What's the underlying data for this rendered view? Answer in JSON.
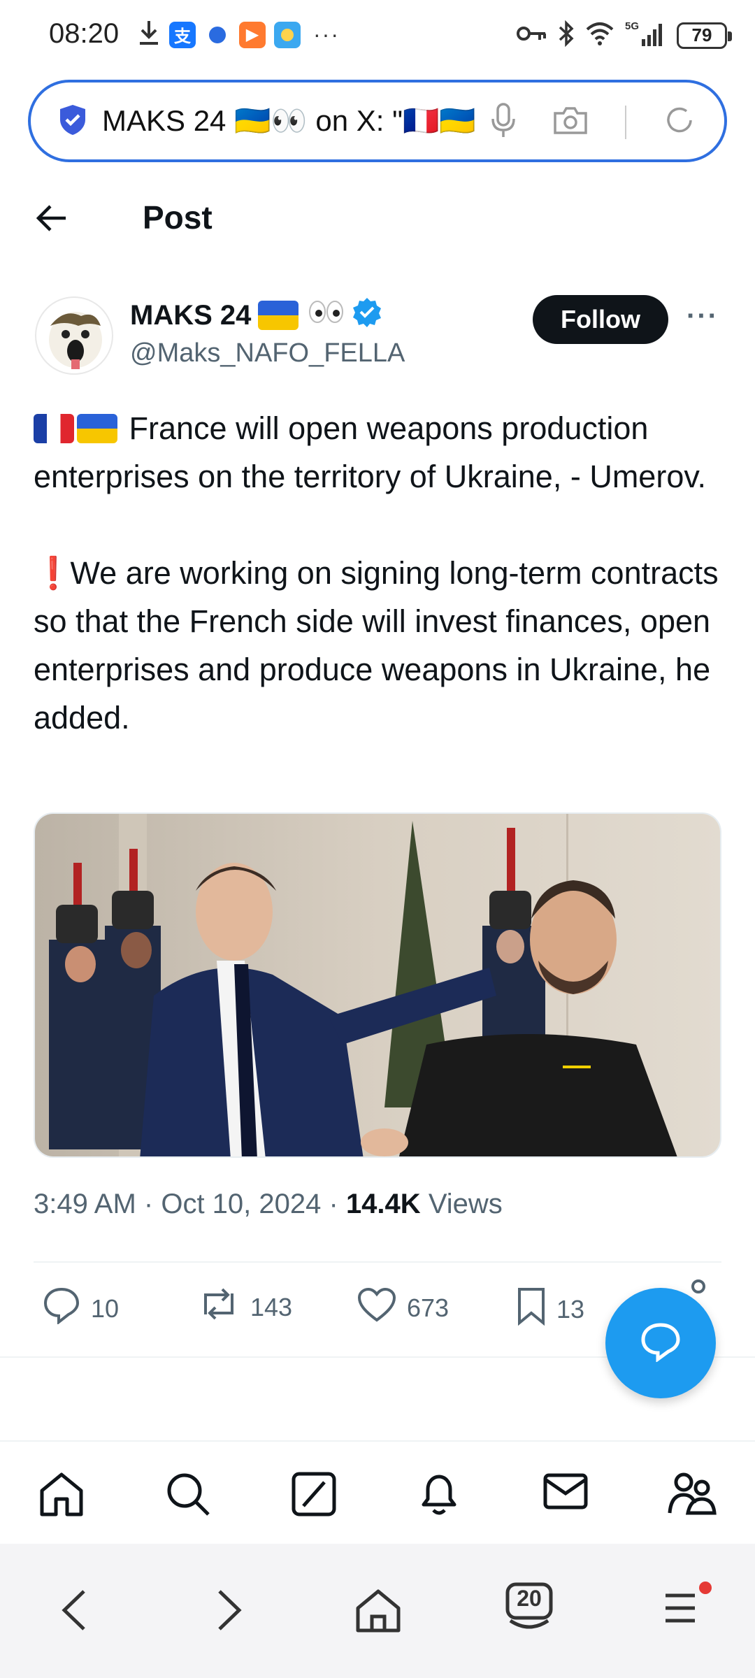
{
  "status_bar": {
    "time": "08:20",
    "battery": "79",
    "network": "5G"
  },
  "address_bar": {
    "url_text": "MAKS 24 🇺🇦👀 on X: \"🇫🇷🇺🇦"
  },
  "post_header": {
    "title": "Post"
  },
  "author": {
    "name": "MAKS 24",
    "handle": "@Maks_NAFO_FELLA",
    "follow_label": "Follow"
  },
  "tweet": {
    "paragraph1": "France will open weapons production enterprises on the territory of Ukraine, - Umerov.",
    "paragraph2": "We are working on signing long-term contracts so that the French side will invest finances, open enterprises and produce weapons in Ukraine, he added."
  },
  "meta": {
    "time": "3:49 AM",
    "date": "Oct 10, 2024",
    "views_count": "14.4K",
    "views_label": "Views"
  },
  "actions": {
    "replies": "10",
    "reposts": "143",
    "likes": "673",
    "bookmarks": "13"
  },
  "browser_nav": {
    "tabs_count": "20"
  },
  "colors": {
    "accent": "#1d9bf0",
    "address_border": "#2f6fe0",
    "text_secondary": "#536471"
  }
}
